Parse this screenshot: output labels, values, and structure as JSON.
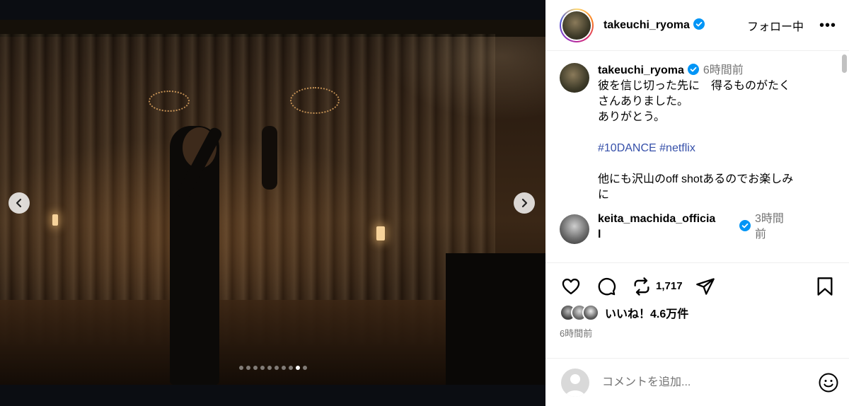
{
  "post": {
    "author": "takeuchi_ryoma",
    "follow_label": "フォロー中",
    "more_label": "•••"
  },
  "media": {
    "slide_count": 10,
    "active_slide": 9,
    "prev_icon": "chevron-left-icon",
    "next_icon": "chevron-right-icon"
  },
  "caption": {
    "user": "takeuchi_ryoma",
    "time": "6時間前",
    "lines": [
      "彼を信じ切った先に　得るものがたく",
      "さんありました。",
      "ありがとう。"
    ],
    "tags": [
      "#10DANCE",
      "#netflix"
    ],
    "footer_lines": [
      "他にも沢山のoff shotあるのでお楽しみ",
      "に"
    ]
  },
  "comments": [
    {
      "user_line1": "keita_machida_officia",
      "user_line2": "l",
      "time_line1": "3時間",
      "time_line2": "前"
    }
  ],
  "actions": {
    "repost_count": "1,717",
    "icons": [
      "heart-icon",
      "comment-icon",
      "repost-icon",
      "share-icon",
      "bookmark-icon"
    ]
  },
  "likes": {
    "text": "いいね！4.6万件"
  },
  "posted_time": "6時間前",
  "composer": {
    "placeholder": "コメントを追加...",
    "emoji_icon": "smiley-icon"
  },
  "colors": {
    "verified": "#0095f6",
    "hashtag": "#3650a9",
    "secondary": "#737373"
  }
}
